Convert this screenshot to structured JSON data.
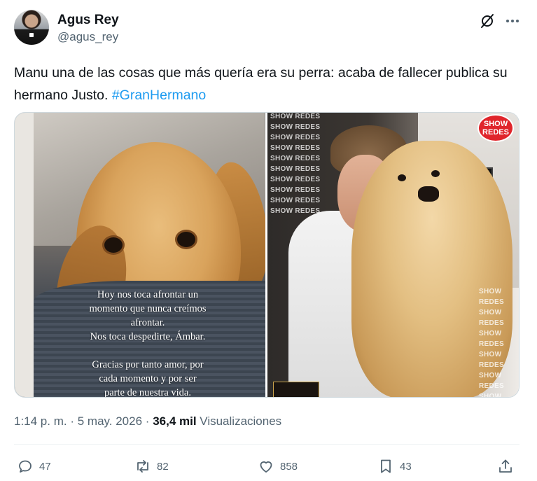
{
  "author": {
    "name": "Agus Rey",
    "handle": "@agus_rey"
  },
  "tweet": {
    "text": "Manu una de las cosas que más quería era su perra: acaba de fallecer publica su hermano Justo. ",
    "hashtag": "#GranHermano"
  },
  "media": {
    "left_caption": "Hoy nos toca afrontar un\nmomento que nunca creímos\nafrontar.\nNos toca despedirte, Ámbar.\n\nGracias por tanto amor, por\ncada momento y por ser\nparte de nuestra vida.",
    "watermark": "SHOW REDES",
    "badge_line1": "SHOW",
    "badge_line2": "REDES"
  },
  "meta": {
    "time": "1:14 p. m.",
    "separator": "·",
    "date": "5 may. 2026",
    "views_count": "36,4 mil",
    "views_label": "Visualizaciones"
  },
  "actions": {
    "replies": "47",
    "reposts": "82",
    "likes": "858",
    "bookmarks": "43"
  },
  "icons": {
    "grok": "grok-icon",
    "more": "more-icon",
    "reply": "reply-icon",
    "repost": "repost-icon",
    "like": "heart-icon",
    "bookmark": "bookmark-icon",
    "share": "share-icon"
  },
  "colors": {
    "accent": "#1d9bf0",
    "text": "#0f1419",
    "muted": "#536471"
  }
}
